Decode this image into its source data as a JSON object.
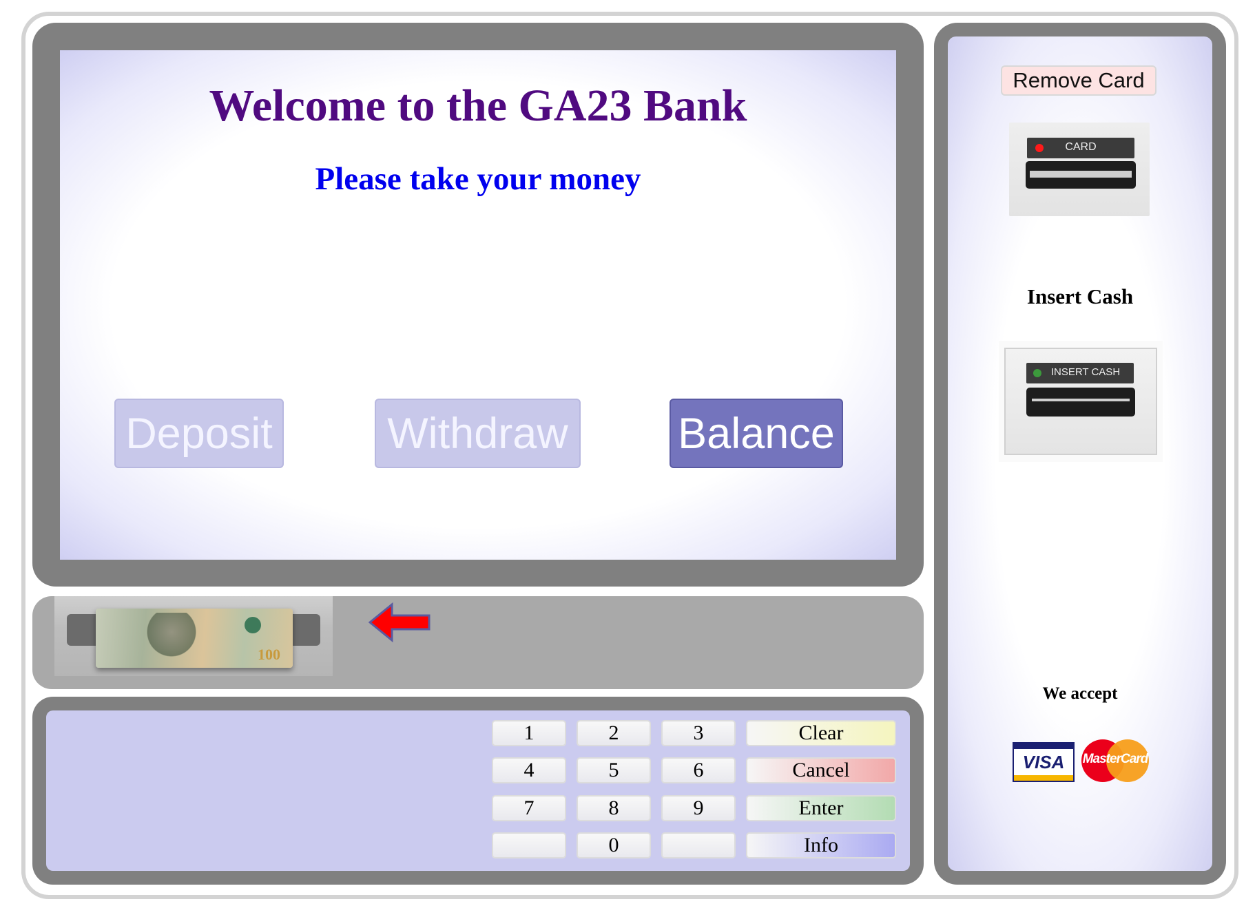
{
  "screen": {
    "welcome": "Welcome to the GA23 Bank",
    "message": "Please take your money",
    "buttons": {
      "deposit": "Deposit",
      "withdraw": "Withdraw",
      "balance": "Balance"
    },
    "colors": {
      "welcome": "#500a80",
      "message": "#0000ee",
      "active_button": "#7474bd",
      "disabled_button": "#c8c8ea"
    }
  },
  "cash_tray": {
    "bill_denomination": "100",
    "arrow_icon": "left-arrow-icon",
    "arrow_color": "#ff0000"
  },
  "keypad": {
    "keys": [
      "1",
      "2",
      "3",
      "4",
      "5",
      "6",
      "7",
      "8",
      "9",
      "",
      "0",
      ""
    ],
    "clear": "Clear",
    "cancel": "Cancel",
    "enter": "Enter",
    "info": "Info"
  },
  "side": {
    "remove_card": "Remove Card",
    "card_reader_label": "CARD",
    "insert_cash_title": "Insert Cash",
    "cash_acceptor_label": "INSERT CASH",
    "we_accept": "We accept",
    "cards": [
      "VISA",
      "MasterCard"
    ]
  }
}
